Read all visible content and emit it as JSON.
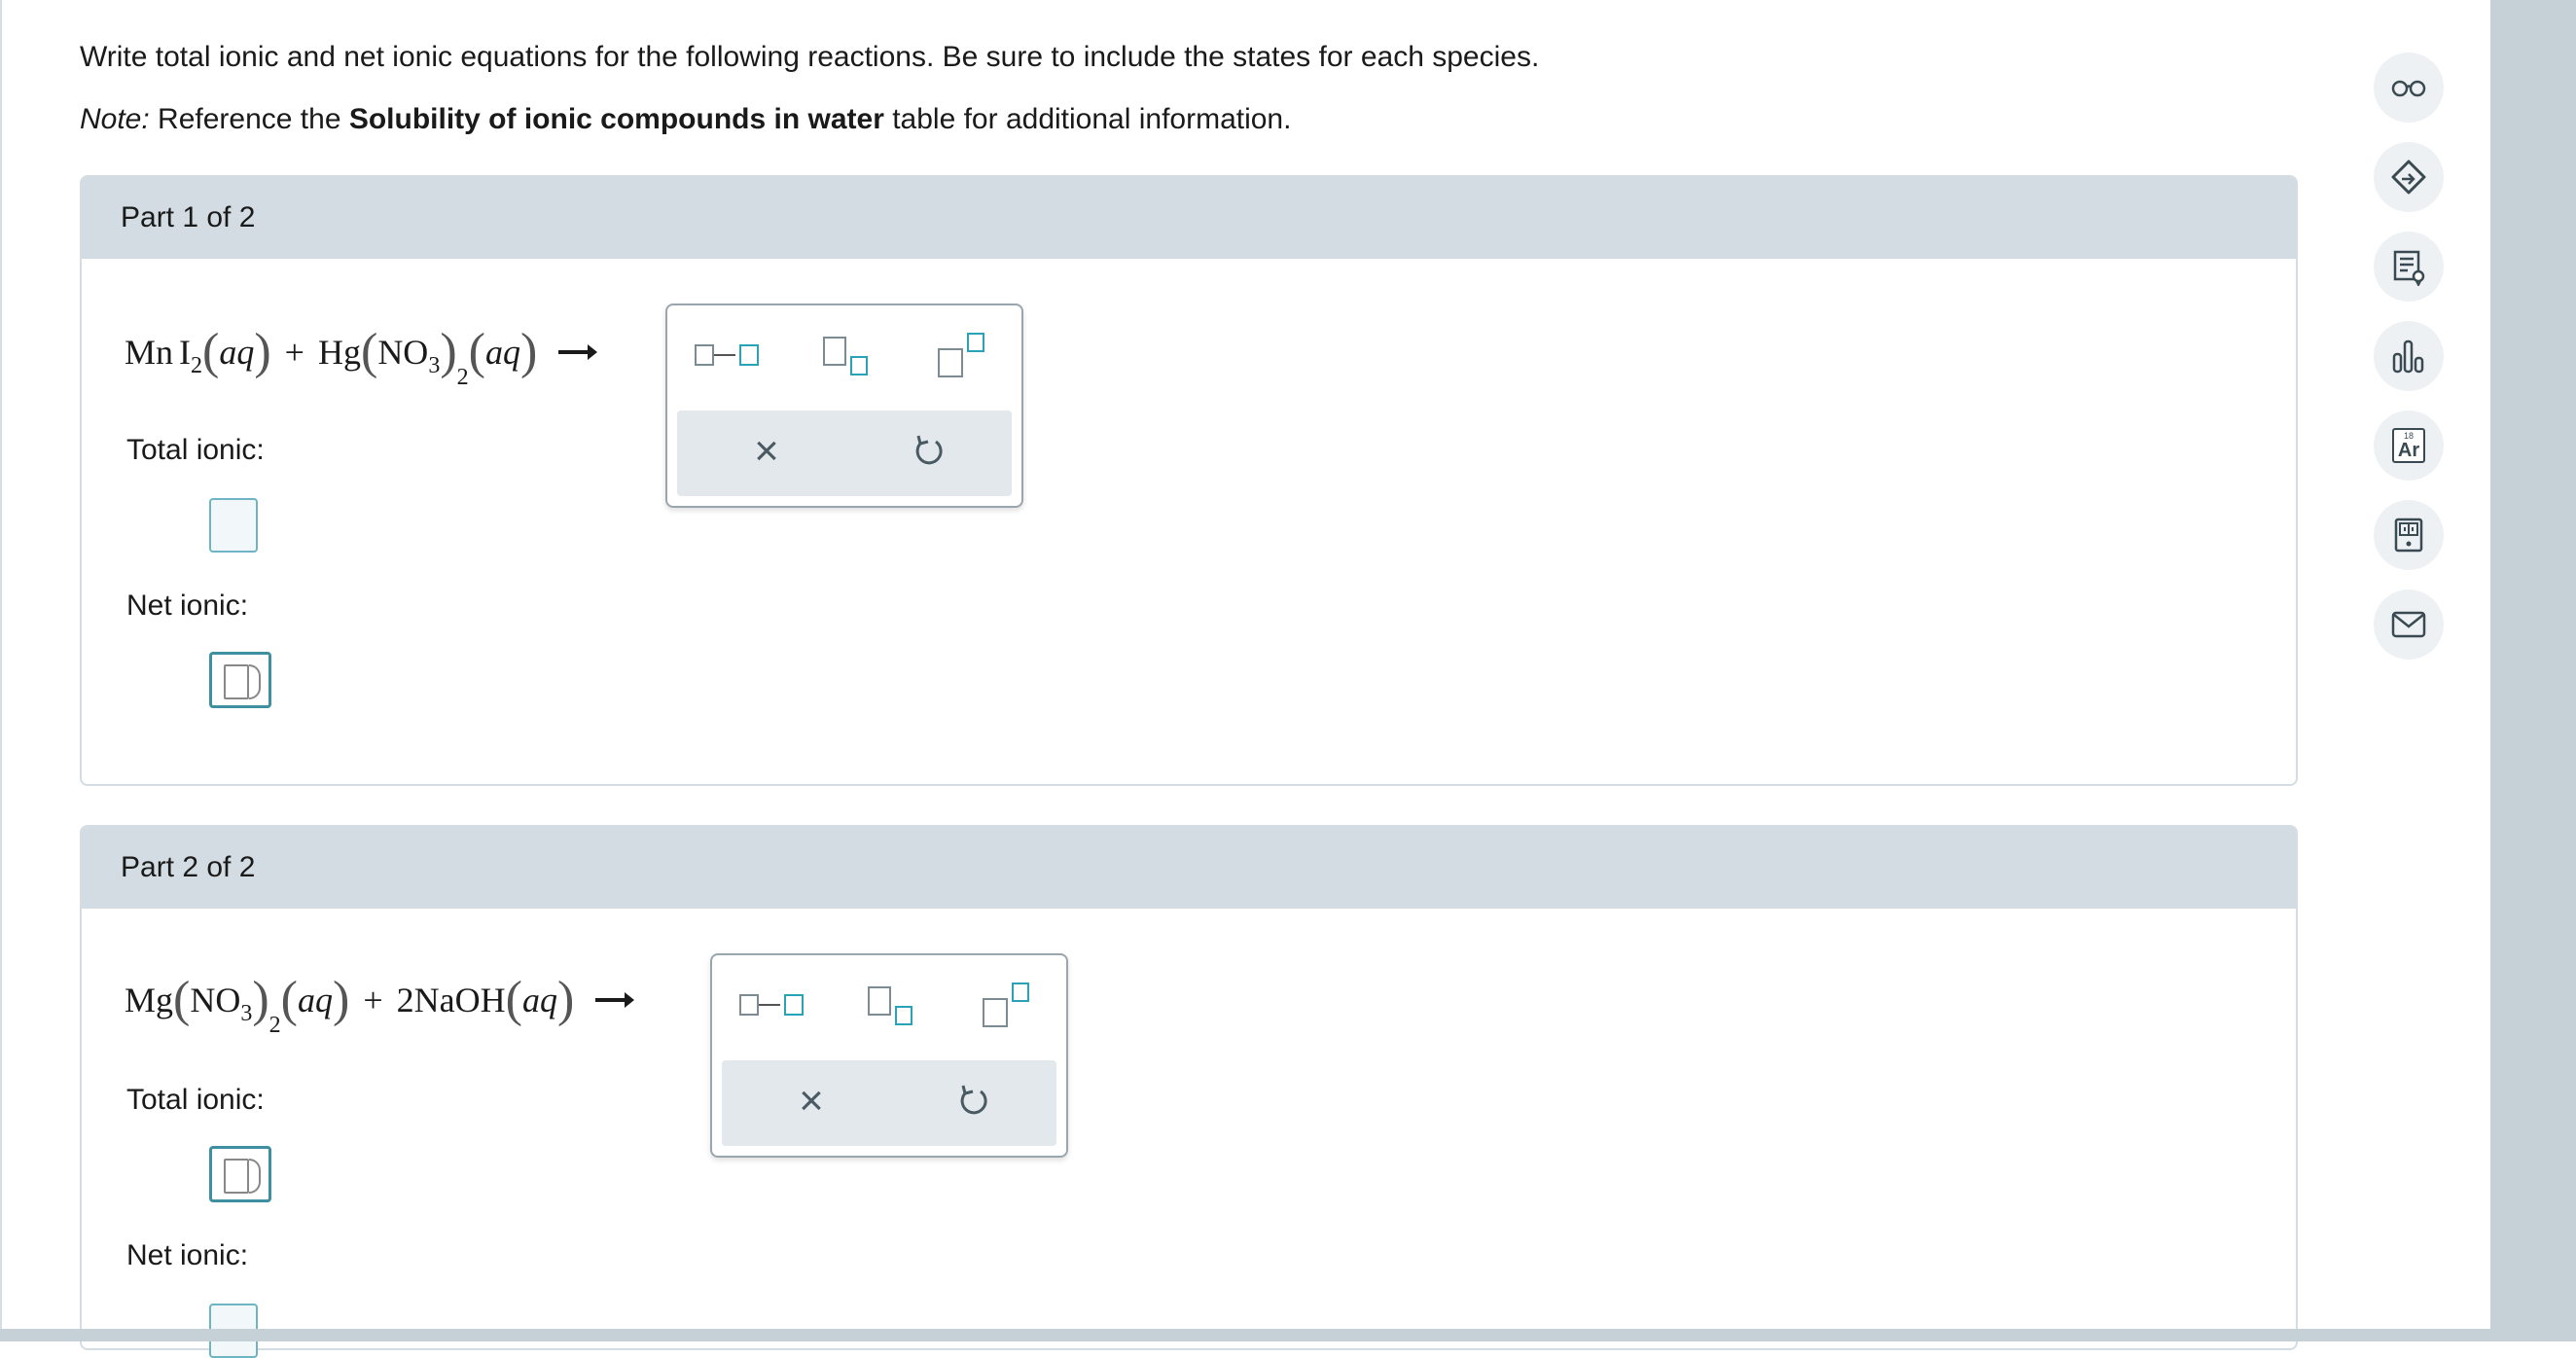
{
  "instructions": {
    "line1": "Write total ionic and net ionic equations for the following reactions. Be sure to include the states for each species.",
    "note_label": "Note:",
    "note_prefix": " Reference the ",
    "note_link": "Solubility of ionic compounds in water",
    "note_suffix": " table for additional information."
  },
  "parts": [
    {
      "header": "Part 1 of 2",
      "total_label": "Total ionic:",
      "net_label": "Net ionic:",
      "eq": {
        "r1_el": "Mn",
        "r1_el2": "I",
        "r1_sub": "2",
        "state": "aq",
        "plus": "+",
        "r2_el": "Hg",
        "r2_group": "NO",
        "r2_group_sub": "3",
        "r2_sub": "2"
      }
    },
    {
      "header": "Part 2 of 2",
      "total_label": "Total ionic:",
      "net_label": "Net ionic:",
      "eq": {
        "r1_el": "Mg",
        "r1_group": "NO",
        "r1_group_sub": "3",
        "r1_sub": "2",
        "state": "aq",
        "plus": "+",
        "r2": "2NaOH"
      }
    }
  ],
  "toolbox": {
    "tools": [
      "reaction-arrow-icon",
      "subscript-icon",
      "superscript-icon"
    ],
    "actions": [
      "clear-icon",
      "undo-icon"
    ],
    "clear_glyph": "×"
  },
  "sidebar": {
    "icons": [
      "glasses-icon",
      "tag-icon",
      "notes-icon",
      "bar-chart-icon",
      "periodic-table-icon",
      "calculator-icon",
      "mail-icon"
    ],
    "periodic": {
      "number": "18",
      "symbol": "Ar"
    }
  },
  "colors": {
    "accent_teal": "#2aa3b8",
    "header_bg": "#d2dce2",
    "side_panel": "#c5d1d7"
  }
}
